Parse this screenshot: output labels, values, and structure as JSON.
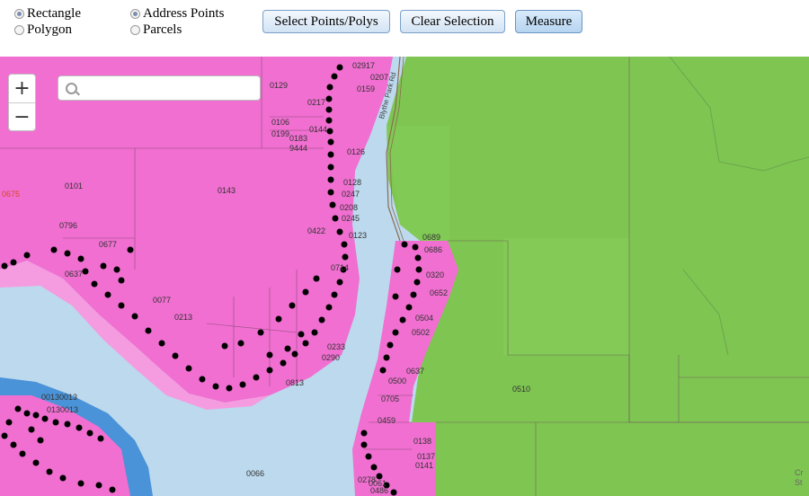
{
  "toolbar": {
    "selection_modes": [
      {
        "label": "Rectangle",
        "selected": true
      },
      {
        "label": "Polygon",
        "selected": false
      }
    ],
    "layers": [
      {
        "label": "Address Points",
        "selected": true
      },
      {
        "label": "Parcels",
        "selected": false
      }
    ],
    "buttons": {
      "select": "Select Points/Polys",
      "clear": "Clear Selection",
      "measure": "Measure"
    }
  },
  "map": {
    "zoom_in": "+",
    "zoom_out": "−",
    "search_placeholder": "",
    "colors": {
      "water": "#bcd9ee",
      "parcel_fill": "#f06fd0",
      "parcel_light": "#f59be0",
      "green_land": "#7fc552",
      "green_light": "#86cf5a",
      "blue_zone": "#4a93d8",
      "address_point": "#000000"
    },
    "road_label": "Blythe Park Rd",
    "parcel_labels": [
      "0129",
      "02917",
      "0207",
      "0159",
      "0217",
      "0106",
      "0199",
      "0183",
      "0144",
      "9444",
      "0126",
      "0101",
      "0143",
      "0128",
      "0247",
      "0208",
      "0245",
      "0675",
      "0796",
      "0422",
      "0123",
      "0689",
      "0677",
      "0686",
      "0320",
      "0637",
      "0714",
      "0652",
      "0077",
      "0213",
      "0504",
      "0502",
      "0510",
      "0637",
      "0500",
      "0705",
      "0459",
      "0233",
      "0290",
      "0813",
      "00130013",
      "0130013",
      "0138",
      "0066",
      "0061",
      "0486",
      "0278",
      "0141",
      "0137"
    ],
    "corner_label": "Cr St"
  }
}
